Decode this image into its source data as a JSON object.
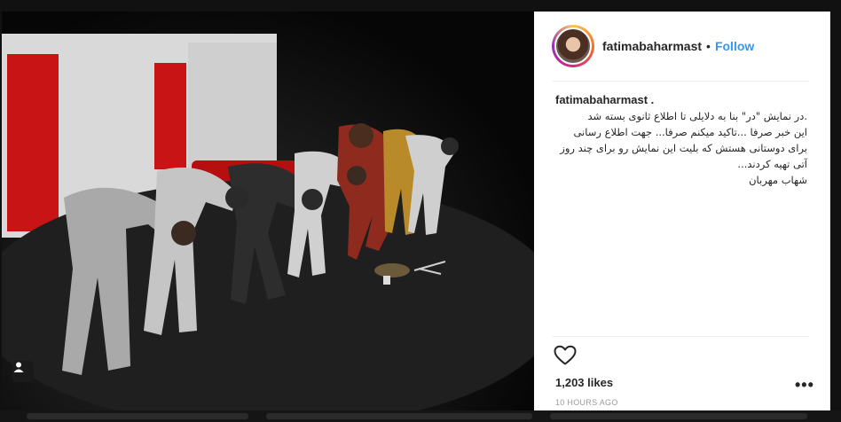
{
  "post": {
    "username": "fatimabaharmast",
    "separator": "•",
    "follow_label": "Follow",
    "caption_username": "fatimabaharmast .",
    "caption_text": ".در نمایش \"در\" بنا به دلایلی تا اطلاع ثانوی بسته شد\nاین خبر صرفا ...تاکید میکنم صرفا... جهت اطلاع رسانی برای دوستانی هستش که بلیت این نمایش رو برای چند روز آتی تهیه کردند...\nشهاب مهربان",
    "likes": "1,203 likes",
    "more_label": "•••",
    "timestamp": "10 HOURS AGO"
  },
  "icons": {
    "like": "heart-outline-icon",
    "more": "more-options-icon",
    "tag": "user-tag-icon"
  },
  "colors": {
    "follow": "#3897f0",
    "stage_doors": "#c81414",
    "text": "#262626"
  }
}
